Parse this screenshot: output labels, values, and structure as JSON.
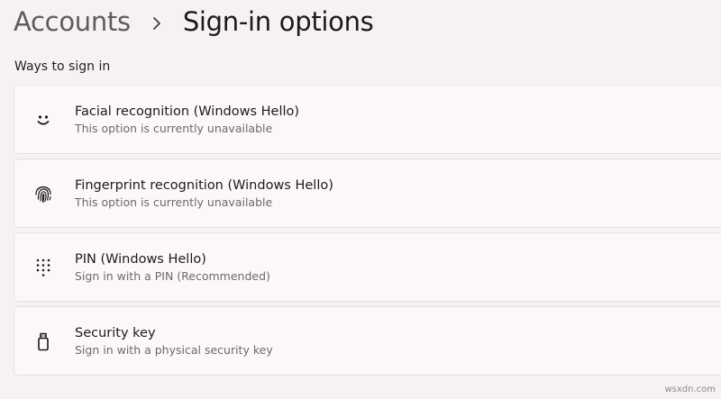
{
  "header": {
    "breadcrumb_parent": "Accounts",
    "breadcrumb_current": "Sign-in options"
  },
  "section": {
    "title": "Ways to sign in"
  },
  "options": [
    {
      "title": "Facial recognition (Windows Hello)",
      "subtitle": "This option is currently unavailable",
      "icon": "smiley-face-icon"
    },
    {
      "title": "Fingerprint recognition (Windows Hello)",
      "subtitle": "This option is currently unavailable",
      "icon": "fingerprint-icon"
    },
    {
      "title": "PIN (Windows Hello)",
      "subtitle": "Sign in with a PIN (Recommended)",
      "icon": "keypad-icon"
    },
    {
      "title": "Security key",
      "subtitle": "Sign in with a physical security key",
      "icon": "usb-key-icon"
    }
  ],
  "watermark": "wsxdn.com",
  "colors": {
    "background": "#f7f2f2",
    "card": "#fcf8f8",
    "card_border": "#e8e1e1",
    "text_primary": "#1b1b1b",
    "text_secondary": "#6a6a6a"
  }
}
